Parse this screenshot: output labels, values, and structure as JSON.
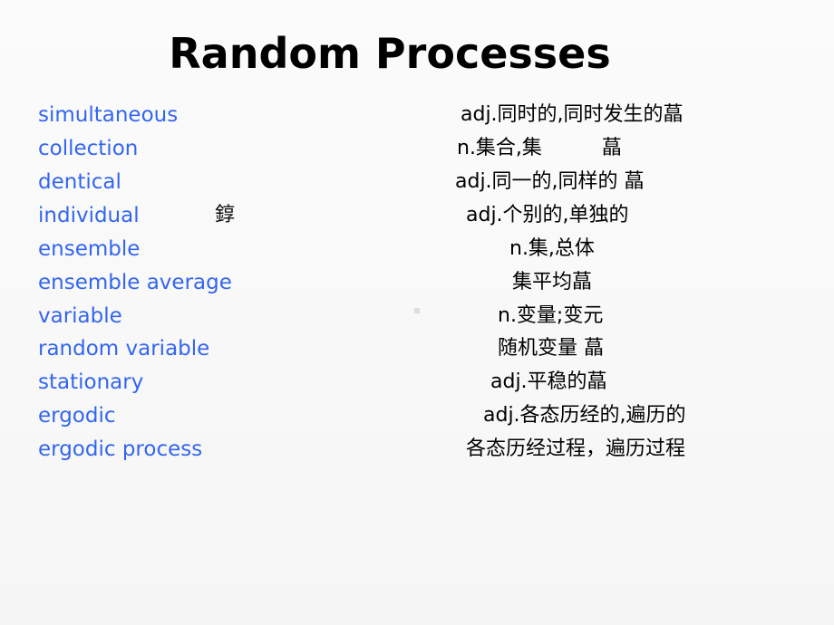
{
  "slide": {
    "title": "Random Processes",
    "rows": [
      {
        "term": "simultaneous",
        "definition": "adj.同时的,同时发生的蕌"
      },
      {
        "term": "collection",
        "definition": "n.集合,集　　　蕌"
      },
      {
        "term": "dentical",
        "definition": "adj.同一的,同样的 蕌"
      },
      {
        "term": "individual",
        "definition": "adj.个别的,单独的",
        "stray_glyph": "錞"
      },
      {
        "term": "ensemble",
        "definition": "n.集,总体"
      },
      {
        "term": "ensemble average",
        "definition": "集平均蕌"
      },
      {
        "term": "variable",
        "definition": "n.变量;变元"
      },
      {
        "term": "random variable",
        "definition": "随机变量 蕌"
      },
      {
        "term": "stationary",
        "definition": "adj.平稳的蕌"
      },
      {
        "term": "ergodic",
        "definition": "adj.各态历经的,遍历的"
      },
      {
        "term": "ergodic process",
        "definition": "各态历经过程，遍历过程"
      }
    ],
    "colors": {
      "term": "#3366ee",
      "definition": "#000000",
      "title": "#000000"
    }
  }
}
